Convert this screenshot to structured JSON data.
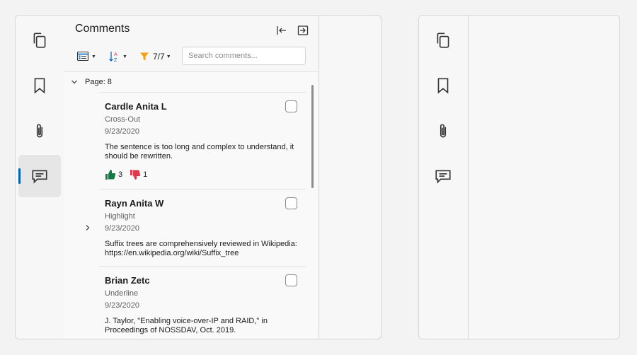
{
  "left_panel": {
    "rail": {
      "items": [
        {
          "icon": "pages-icon",
          "active": false
        },
        {
          "icon": "bookmark-icon",
          "active": false
        },
        {
          "icon": "attachment-icon",
          "active": false
        },
        {
          "icon": "comments-icon",
          "active": true
        }
      ]
    },
    "header": {
      "title": "Comments"
    },
    "toolbar": {
      "view_icon": "list-view-icon",
      "sort_icon": "sort-az-icon",
      "filter_icon": "filter-icon",
      "filter_count": "7/7",
      "search_placeholder": "Search comments..."
    },
    "group": {
      "label": "Page: 8"
    },
    "comments": [
      {
        "author": "Cardle Anita L",
        "type": "Cross-Out",
        "date": "9/23/2020",
        "body": "The sentence is too long and complex to understand, it should be rewritten.",
        "likes": "3",
        "dislikes": "1"
      },
      {
        "author": "Rayn Anita W",
        "type": "Highlight",
        "date": "9/23/2020",
        "body": "Suffix trees are comprehensively reviewed in Wikipedia: https://en.wikipedia.org/wiki/Suffix_tree"
      },
      {
        "author": "Brian Zetc",
        "type": "Underline",
        "date": "9/23/2020",
        "body": "J. Taylor, \"Enabling voice-over-IP and RAID,\" in Proceedings of NOSSDAV, Oct. 2019."
      }
    ]
  },
  "right_panel": {
    "rail": {
      "items": [
        {
          "icon": "pages-icon"
        },
        {
          "icon": "bookmark-icon"
        },
        {
          "icon": "attachment-icon"
        },
        {
          "icon": "comments-icon"
        }
      ]
    }
  },
  "colors": {
    "accent": "#005fb8",
    "like": "#107c41",
    "dislike": "#e0394b",
    "filter": "#f7a00d"
  }
}
